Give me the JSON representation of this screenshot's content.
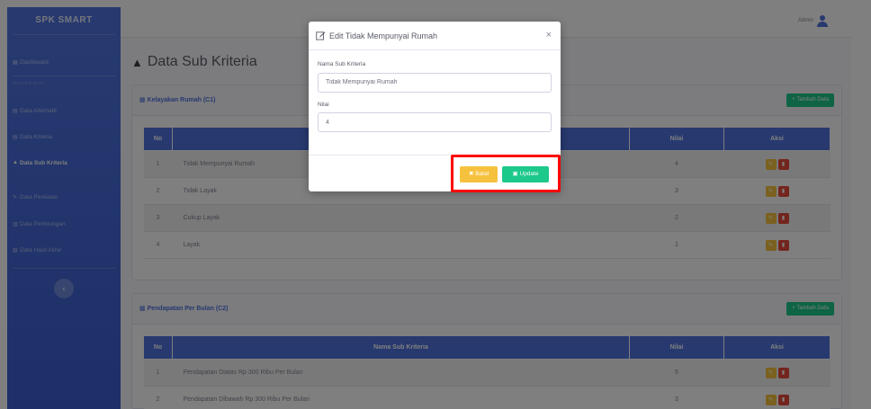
{
  "brand": "SPK SMART",
  "sidebar": {
    "heading": "MASTER DATA",
    "items": [
      {
        "label": "Dashboard",
        "icon": "dashboard-icon"
      },
      {
        "label": "Data Alternatif",
        "icon": "table-icon"
      },
      {
        "label": "Data Kriteria",
        "icon": "table-icon"
      },
      {
        "label": "Data Sub Kriteria",
        "icon": "cubes-icon",
        "active": true
      },
      {
        "label": "Data Penilaian",
        "icon": "edit-icon"
      },
      {
        "label": "Data Perhitungan",
        "icon": "calculator-icon"
      },
      {
        "label": "Data Hasil Akhir",
        "icon": "chart-icon"
      }
    ]
  },
  "topbar": {
    "user_name": "Admin"
  },
  "page": {
    "title": "Data Sub Kriteria"
  },
  "cards": [
    {
      "title": "Kelayakan Rumah (C1)",
      "add_label": "+ Tambah Data",
      "columns": [
        "No",
        "Nama Sub Kriteria",
        "Nilai",
        "Aksi"
      ],
      "rows": [
        {
          "no": "1",
          "name": "Tidak Mempunyai Rumah",
          "nilai": "4"
        },
        {
          "no": "2",
          "name": "Tidak Layak",
          "nilai": "3"
        },
        {
          "no": "3",
          "name": "Cukup Layak",
          "nilai": "2"
        },
        {
          "no": "4",
          "name": "Layak",
          "nilai": "1"
        }
      ]
    },
    {
      "title": "Pendapatan Per Bulan (C2)",
      "add_label": "+ Tambah Data",
      "columns": [
        "No",
        "Nama Sub Kriteria",
        "Nilai",
        "Aksi"
      ],
      "rows": [
        {
          "no": "1",
          "name": "Pendapatan Diatas Rp 300 Ribu Per Bulan",
          "nilai": "5"
        },
        {
          "no": "2",
          "name": "Pendapatan Dibawah Rp 300 Ribu Per Bulan",
          "nilai": "3"
        }
      ]
    }
  ],
  "modal": {
    "title": "Edit Tidak Mempunyai Rumah",
    "close_symbol": "×",
    "fields": [
      {
        "label": "Nama Sub Kriteria",
        "value": "Tidak Mempunyai Rumah"
      },
      {
        "label": "Nilai",
        "value": "4"
      }
    ],
    "cancel_label": "✖ Batal",
    "update_label": "Update"
  },
  "colors": {
    "primary": "#4e73df",
    "success": "#1cc88a",
    "warning": "#f6c23e",
    "danger": "#e74a3b",
    "highlight": "#ff0000"
  }
}
